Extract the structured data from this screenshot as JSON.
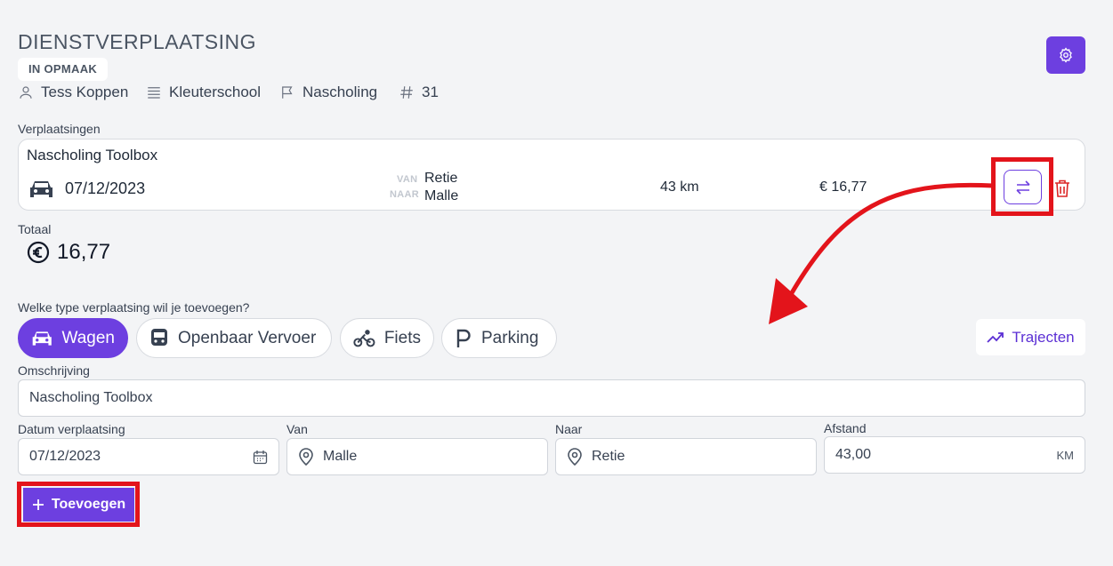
{
  "header": {
    "title": "DIENSTVERPLAATSING",
    "status": "IN OPMAAK",
    "person": "Tess Koppen",
    "school": "Kleuterschool",
    "category": "Nascholing",
    "number": "31"
  },
  "trips_section": {
    "label": "Verplaatsingen",
    "trip": {
      "title": "Nascholing Toolbox",
      "date": "07/12/2023",
      "from_tag": "VAN",
      "from": "Retie",
      "to_tag": "NAAR",
      "to": "Malle",
      "distance": "43 km",
      "cost": "€ 16,77"
    }
  },
  "total": {
    "label": "Totaal",
    "amount": "16,77"
  },
  "type_question": "Welke type verplaatsing wil je toevoegen?",
  "types": [
    {
      "label": "Wagen",
      "icon": "car-icon",
      "active": true
    },
    {
      "label": "Openbaar Vervoer",
      "icon": "train-icon",
      "active": false
    },
    {
      "label": "Fiets",
      "icon": "bike-icon",
      "active": false
    },
    {
      "label": "Parking",
      "icon": "parking-icon",
      "active": false
    }
  ],
  "trajecten_label": "Trajecten",
  "form": {
    "description_label": "Omschrijving",
    "description_value": "Nascholing Toolbox",
    "date_label": "Datum verplaatsing",
    "date_value": "07/12/2023",
    "from_label": "Van",
    "from_value": "Malle",
    "to_label": "Naar",
    "to_value": "Retie",
    "distance_label": "Afstand",
    "distance_value": "43,00",
    "distance_unit": "KM"
  },
  "add_label": "Toevoegen",
  "colors": {
    "accent": "#6d3fe0",
    "highlight": "#e3141b",
    "delete": "#dc2626",
    "background": "#f3f4f6"
  }
}
